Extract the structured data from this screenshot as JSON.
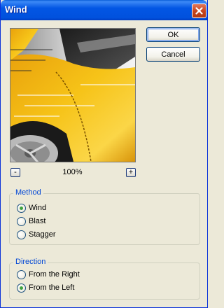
{
  "window": {
    "title": "Wind",
    "close_icon": "close-icon"
  },
  "buttons": {
    "ok": "OK",
    "cancel": "Cancel"
  },
  "zoom": {
    "minus": "-",
    "plus": "+",
    "value": "100%"
  },
  "method": {
    "legend": "Method",
    "options": [
      {
        "label": "Wind",
        "checked": true
      },
      {
        "label": "Blast",
        "checked": false
      },
      {
        "label": "Stagger",
        "checked": false
      }
    ]
  },
  "direction": {
    "legend": "Direction",
    "options": [
      {
        "label": "From the Right",
        "checked": false
      },
      {
        "label": "From the Left",
        "checked": true
      }
    ]
  },
  "colors": {
    "title_bar": "#0256e4",
    "group_label": "#0046d5",
    "radio_dot": "#3fa23f",
    "preview_car": "#f2b810"
  }
}
